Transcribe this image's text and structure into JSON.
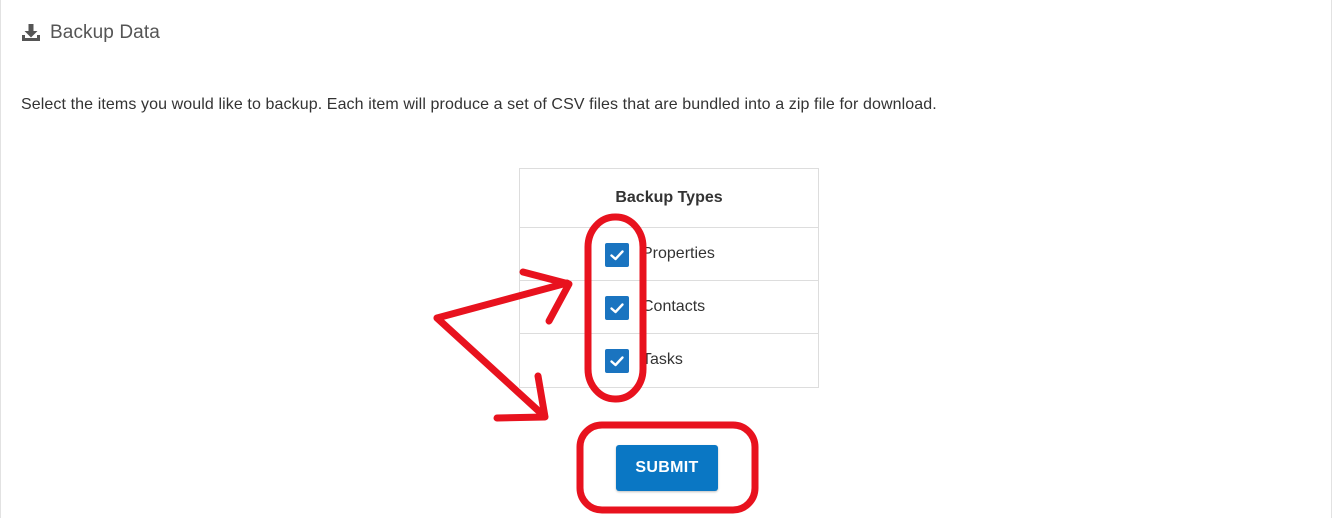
{
  "header": {
    "icon": "download-icon",
    "title": "Backup Data"
  },
  "description": "Select the items you would like to backup. Each item will produce a set of CSV files that are bundled into a zip file for download.",
  "backup_types": {
    "heading": "Backup Types",
    "items": [
      {
        "label": "Properties",
        "checked": true
      },
      {
        "label": "Contacts",
        "checked": true
      },
      {
        "label": "Tasks",
        "checked": true
      }
    ]
  },
  "submit_label": "SUBMIT",
  "colors": {
    "checkbox": "#1a74c0",
    "button": "#0a77c4",
    "annotation": "#e8121e"
  }
}
